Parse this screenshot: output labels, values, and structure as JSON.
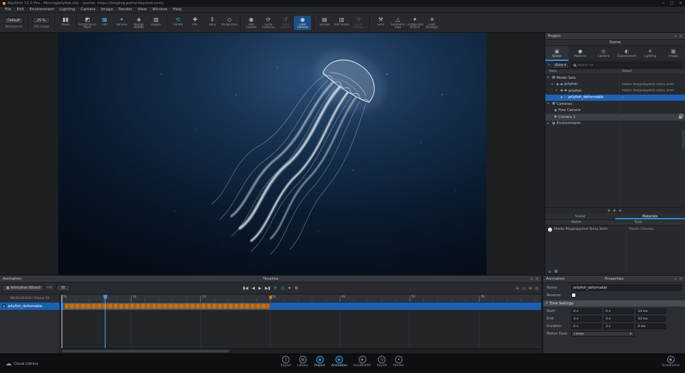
{
  "colors": {
    "accent_blue": "#1e63b5",
    "icon_blue": "#4da0e8",
    "clip_orange": "#bf7320",
    "selected_tab_blue": "#3d8ede"
  },
  "window": {
    "title": "KeyShot 11.0 Pro - MovingJellyfish.bip - (portal: https://staging.portal.keyshot.com)",
    "minimize": "─",
    "maximize": "□",
    "close": "×",
    "menus": [
      "File",
      "Edit",
      "Environment",
      "Lighting",
      "Camera",
      "Image",
      "Render",
      "View",
      "Window",
      "Help"
    ]
  },
  "toolbar": {
    "workspace": {
      "value": "Default",
      "label": "Workspaces"
    },
    "cpu": {
      "value": "25 %",
      "label": "CPU Usage"
    },
    "items": [
      {
        "glyph": "▮▮",
        "label": "Pause"
      },
      {
        "glyph": "◩",
        "label": "Performance Mode"
      },
      {
        "glyph": "▦",
        "label": "GPU"
      },
      {
        "glyph": "✦",
        "label": "Denoise"
      },
      {
        "glyph": "◈",
        "label": "Render NURBS"
      },
      {
        "glyph": "▧",
        "label": "Region"
      },
      {
        "glyph": "⟲",
        "label": "Tumble"
      },
      {
        "glyph": "✚",
        "label": "Pan"
      },
      {
        "glyph": "⇕",
        "label": "Dolly"
      },
      {
        "glyph": "◇",
        "label": "Perspective"
      },
      {
        "glyph": "◉",
        "label": "Add Camera"
      },
      {
        "glyph": "⟳",
        "label": "Cycle Cameras"
      },
      {
        "glyph": "↺",
        "label": "Reset Camera"
      },
      {
        "glyph": "◉",
        "label": "Lock Camera"
      },
      {
        "glyph": "▤",
        "label": "Studios"
      },
      {
        "glyph": "▥",
        "label": "Add Studio"
      },
      {
        "glyph": "⟳",
        "label": "Cycle Studios"
      },
      {
        "glyph": "⚒",
        "label": "Tools"
      },
      {
        "glyph": "△",
        "label": "Geometry View"
      },
      {
        "glyph": "✦",
        "label": "Configurator Wizard"
      },
      {
        "glyph": "☀",
        "label": "Light Manager"
      }
    ]
  },
  "project": {
    "panel_title": "Project",
    "scene_title": "Scene",
    "tabs": [
      {
        "glyph": "▣",
        "label": "Scene"
      },
      {
        "glyph": "●",
        "label": "Material"
      },
      {
        "glyph": "◎",
        "label": "Camera"
      },
      {
        "glyph": "◐",
        "label": "Environment"
      },
      {
        "glyph": "☀",
        "label": "Lighting"
      },
      {
        "glyph": "▦",
        "label": "Image"
      }
    ],
    "filter": {
      "show_label": "Show",
      "caret": "▾",
      "search_placeholder": "Search All"
    },
    "columns": {
      "item": "Item",
      "detail": "Detail"
    },
    "icons": {
      "eye": "◉"
    },
    "tree": [
      {
        "expander": "▾",
        "glyph": "▦",
        "label": "Model Sets",
        "detail": ""
      },
      {
        "expander": "▾",
        "glyph": "◆",
        "label": "jellyfish",
        "detail": "Plastic Polypropylene Shiny 3mm"
      },
      {
        "expander": "▾",
        "glyph": "◆",
        "label": "jellyfish",
        "detail": "Plastic Polypropylene Shiny 3mm"
      },
      {
        "expander": "",
        "glyph": "◇",
        "label": "jellyfish_deformable",
        "detail": "-"
      },
      {
        "expander": "▾",
        "glyph": "▦",
        "label": "Cameras",
        "detail": ""
      },
      {
        "expander": "",
        "glyph": "◉",
        "label": "Free Camera",
        "detail": "-"
      },
      {
        "expander": "",
        "glyph": "◉",
        "label": "Camera 1",
        "detail": "-"
      },
      {
        "expander": "▸",
        "glyph": "▦",
        "label": "Environments",
        "detail": ""
      }
    ],
    "subtabs": {
      "scene": "Scene",
      "materials": "Materials"
    },
    "materials": {
      "columns": {
        "name": "Name",
        "type": "Type"
      },
      "rows": [
        {
          "name": "Plastic Polypropylene Shiny 3mm",
          "type": "Plastic (Cloudy)"
        }
      ]
    }
  },
  "timeline": {
    "panel_title": "Animation",
    "center_title": "Timeline",
    "wizard_label": "Animation Wizard",
    "fps_label": "FPS:",
    "fps_value": "30",
    "time_display": "00:00:00:633 / Frame 19",
    "transport": [
      {
        "name": "skip-start",
        "glyph": "▮◀"
      },
      {
        "name": "step-back",
        "glyph": "◀"
      },
      {
        "name": "play",
        "glyph": "▶"
      },
      {
        "name": "skip-end",
        "glyph": "▶▮"
      },
      {
        "name": "loop",
        "glyph": "⟳"
      },
      {
        "name": "stopwatch",
        "glyph": "◷"
      },
      {
        "name": "keyframe-wizard",
        "glyph": "✦"
      },
      {
        "name": "settings",
        "glyph": "⚙"
      }
    ],
    "zoom": [
      {
        "name": "zoom-out",
        "glyph": "⊖"
      },
      {
        "name": "zoom-bar",
        "glyph": "▭"
      },
      {
        "name": "zoom-in",
        "glyph": "⊕"
      },
      {
        "name": "zoom-fit",
        "glyph": "◎"
      }
    ],
    "ruler": [
      "0s",
      "1s",
      "2s",
      "3s",
      "4s",
      "5s",
      "6s"
    ],
    "track": {
      "label": "jellyfish_deformable",
      "start_s": 0.05,
      "end_s": 3.0
    },
    "playhead_s": 0.633
  },
  "properties": {
    "panel_title": "Animation",
    "center_title": "Properties",
    "name_label": "Name:",
    "name_value": "jellyfish_deformable",
    "reverse_label": "Reverse:",
    "section_time": "Time Settings",
    "section_caret": "▾",
    "time_rows": [
      {
        "label": "Start:",
        "v1": "0 s",
        "v2": "0 s",
        "v3": "33 ms"
      },
      {
        "label": "End:",
        "v1": "3 s",
        "v2": "3 s",
        "v3": "33 ms"
      },
      {
        "label": "Duration:",
        "v1": "0 s",
        "v2": "3 s",
        "v3": "0 ms"
      }
    ],
    "motion_ease": {
      "label": "Motion Ease:",
      "value": "Linear",
      "caret": "▾"
    }
  },
  "dock": {
    "cloud_glyph": "☁",
    "cloud_label": "Cloud Library",
    "items": [
      {
        "glyph": "↧",
        "label": "Import"
      },
      {
        "glyph": "▤",
        "label": "Library"
      },
      {
        "glyph": "◉",
        "label": "Project"
      },
      {
        "glyph": "▶",
        "label": "Animation"
      },
      {
        "glyph": "◈",
        "label": "KeyShotXR"
      },
      {
        "glyph": "◎",
        "label": "KeyVR"
      },
      {
        "glyph": "✦",
        "label": "Render"
      }
    ],
    "screenshot_glyph": "◉",
    "screenshot_label": "Screenshot"
  }
}
